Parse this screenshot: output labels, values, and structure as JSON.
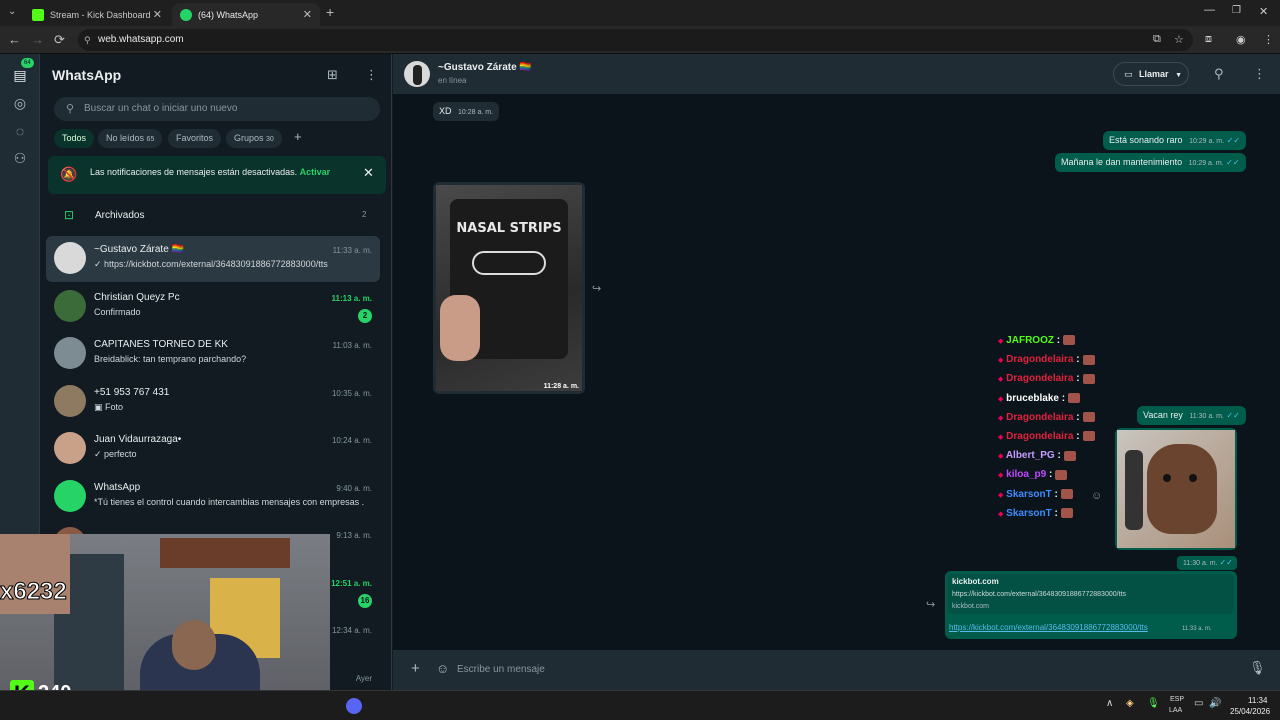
{
  "browser": {
    "tabs": [
      {
        "label": "Stream - Kick Dashboard",
        "color": "#53fc18"
      },
      {
        "label": "(64) WhatsApp",
        "color": "#25d366"
      }
    ],
    "url": "web.whatsapp.com"
  },
  "rail": {
    "chats_badge": "64"
  },
  "sidebar": {
    "title": "WhatsApp",
    "search_placeholder": "Buscar un chat o iniciar uno nuevo",
    "filters": [
      {
        "label": "Todos",
        "count": ""
      },
      {
        "label": "No leídos",
        "count": "65"
      },
      {
        "label": "Favoritos",
        "count": ""
      },
      {
        "label": "Grupos",
        "count": "30"
      }
    ],
    "notice": {
      "text": "Las notificaciones de mensajes están desactivadas.",
      "action": "Activar"
    },
    "archived": {
      "label": "Archivados",
      "count": "2"
    },
    "chats": [
      {
        "name": "~Gustavo Zárate 🏳️‍🌈",
        "preview": "✓ https://kickbot.com/external/364830918867728830​00/tts",
        "time": "11:33 a. m.",
        "badge": ""
      },
      {
        "name": "Christian Queyz Pc",
        "preview": "Confirmado",
        "time": "11:13 a. m.",
        "badge": "2"
      },
      {
        "name": "CAPITANES TORNEO DE KK",
        "preview": "Breidablick: tan temprano parchando?",
        "time": "11:03 a. m.",
        "badge": ""
      },
      {
        "name": "+51 953 767 431",
        "preview": "▣ Foto",
        "time": "10:35 a. m.",
        "badge": ""
      },
      {
        "name": "Juan Vidaurrazaga•",
        "preview": "✓ perfecto",
        "time": "10:24 a. m.",
        "badge": ""
      },
      {
        "name": "WhatsApp",
        "preview": "*Tú tienes el control cuando intercambias mensajes con empresas ...",
        "time": "9:40 a. m.",
        "badge": ""
      },
      {
        "name": "",
        "preview": "",
        "time": "9:13 a. m.",
        "badge": ""
      },
      {
        "name": "",
        "preview": "",
        "time": "12:51 a. m.",
        "badge": "16"
      },
      {
        "name": "",
        "preview": "",
        "time": "12:34 a. m.",
        "badge": ""
      },
      {
        "name": "",
        "preview": "",
        "time": "Ayer",
        "badge": ""
      }
    ]
  },
  "chat": {
    "contact": "~Gustavo Zárate 🏳️‍🌈",
    "status": "en línea",
    "call_label": "Llamar",
    "messages": [
      {
        "dir": "in",
        "text": "XD",
        "time": "10:28 a. m."
      },
      {
        "dir": "out",
        "text": "Está sonando raro",
        "time": "10:29 a. m."
      },
      {
        "dir": "out",
        "text": "Mañana le dan mantenimiento",
        "time": "10:29 a. m."
      },
      {
        "dir": "in",
        "image": "NASAL STRIPS",
        "time": "11:28 a. m."
      },
      {
        "dir": "out",
        "text": "Vacan rey",
        "time": "11:30 a. m."
      },
      {
        "dir": "out",
        "image": "dog",
        "time": "11:30 a. m."
      },
      {
        "dir": "out",
        "link_title": "kickbot.com",
        "link_desc": "https://kickbot.com/external/36483091886772883000/tts",
        "link_domain": "kickbot.com",
        "text": "https://kickbot.com/external/36483091886772883000/tts",
        "time": "11:33 a. m."
      }
    ],
    "composer_placeholder": "Escribe un mensaje"
  },
  "overlay_chat": [
    {
      "user": "JAFROOZ",
      "color": "#53fc18"
    },
    {
      "user": "Dragondelaira",
      "color": "#e0223e"
    },
    {
      "user": "Dragondelaira",
      "color": "#e0223e"
    },
    {
      "user": "bruceblake",
      "color": "#ffffff"
    },
    {
      "user": "Dragondelaira",
      "color": "#e0223e"
    },
    {
      "user": "Dragondelaira",
      "color": "#e0223e"
    },
    {
      "user": "Albert_PG",
      "color": "#c79bff"
    },
    {
      "user": "kiloa_p9",
      "color": "#c04aff"
    },
    {
      "user": "SkarsonT",
      "color": "#3d8cff"
    },
    {
      "user": "SkarsonT",
      "color": "#3d8cff"
    }
  ],
  "stream": {
    "viewer_text": "x6232",
    "kick_count": "240"
  },
  "taskbar": {
    "lang_top": "ESP",
    "lang_bottom": "LAA",
    "time": "11:34",
    "date": "25/04/2026"
  }
}
